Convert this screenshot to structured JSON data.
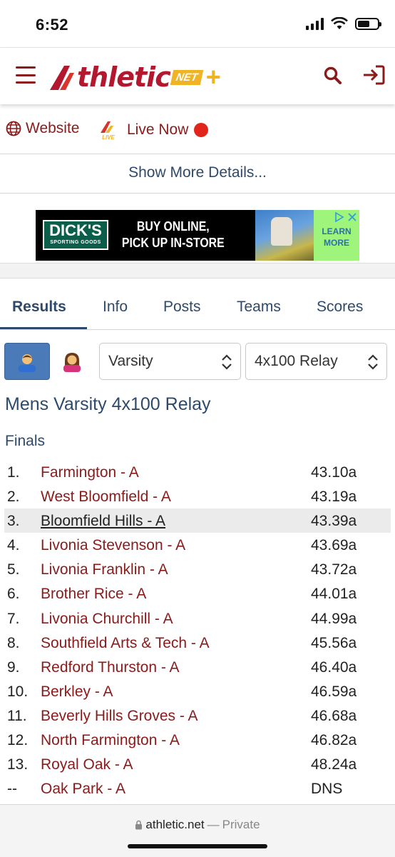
{
  "status_bar": {
    "time": "6:52"
  },
  "header": {
    "logo_main": "thletic",
    "logo_net": "NET",
    "logo_plus": "+"
  },
  "links": {
    "website": "Website",
    "live_badge": "LIVE",
    "live_now": "Live Now"
  },
  "show_more": "Show More Details...",
  "ad": {
    "logo_big": "DICK'S",
    "logo_small": "SPORTING GOODS",
    "line1": "BUY ONLINE,",
    "line2": "PICK UP IN-STORE",
    "cta": "LEARN MORE"
  },
  "tabs": [
    {
      "label": "Results",
      "active": true
    },
    {
      "label": "Info"
    },
    {
      "label": "Posts"
    },
    {
      "label": "Teams"
    },
    {
      "label": "Scores"
    }
  ],
  "filters": {
    "level": "Varsity",
    "event": "4x100 Relay"
  },
  "page_title": "Mens Varsity 4x100 Relay",
  "section": "Finals",
  "results": [
    {
      "place": "1.",
      "team": "Farmington - A",
      "time": "43.10a"
    },
    {
      "place": "2.",
      "team": "West Bloomfield - A",
      "time": "43.19a"
    },
    {
      "place": "3.",
      "team": "Bloomfield Hills - A",
      "time": "43.39a"
    },
    {
      "place": "4.",
      "team": "Livonia Stevenson - A",
      "time": "43.69a"
    },
    {
      "place": "5.",
      "team": "Livonia Franklin - A",
      "time": "43.72a"
    },
    {
      "place": "6.",
      "team": "Brother Rice - A",
      "time": "44.01a"
    },
    {
      "place": "7.",
      "team": "Livonia Churchill - A",
      "time": "44.99a"
    },
    {
      "place": "8.",
      "team": "Southfield Arts & Tech - A",
      "time": "45.56a"
    },
    {
      "place": "9.",
      "team": "Redford Thurston - A",
      "time": "46.40a"
    },
    {
      "place": "10.",
      "team": "Berkley - A",
      "time": "46.59a"
    },
    {
      "place": "11.",
      "team": "Beverly Hills Groves - A",
      "time": "46.68a"
    },
    {
      "place": "12.",
      "team": "North Farmington - A",
      "time": "46.82a"
    },
    {
      "place": "13.",
      "team": "Royal Oak - A",
      "time": "48.24a"
    },
    {
      "place": "--",
      "team": "Oak Park - A",
      "time": "DNS"
    }
  ],
  "browser": {
    "url": "athletic.net",
    "separator": "—",
    "mode": "Private"
  },
  "colors": {
    "brand_red": "#8b1a1a",
    "navy": "#2d4a6b",
    "live_dot": "#e1251b",
    "logo_gold": "#f0b323"
  }
}
